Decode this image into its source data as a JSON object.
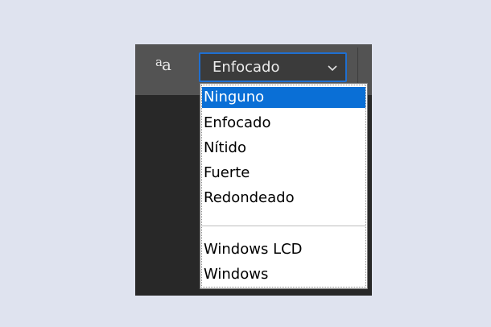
{
  "toolbar": {
    "antialias_icon": "aa-icon",
    "select": {
      "value": "Enfocado",
      "chevron_icon": "chevron-down-icon"
    }
  },
  "dropdown": {
    "options": [
      {
        "label": "Ninguno",
        "selected": true
      },
      {
        "label": "Enfocado",
        "selected": false
      },
      {
        "label": "Nítido",
        "selected": false
      },
      {
        "label": "Fuerte",
        "selected": false
      },
      {
        "label": "Redondeado",
        "selected": false
      },
      {
        "label": "Windows LCD",
        "selected": false
      },
      {
        "label": "Windows",
        "selected": false
      }
    ]
  },
  "colors": {
    "page_background": "#dfe3ef",
    "toolbar": "#535353",
    "canvas": "#282828",
    "selection": "#0a6fd6",
    "focus_border": "#1f6fd1"
  }
}
